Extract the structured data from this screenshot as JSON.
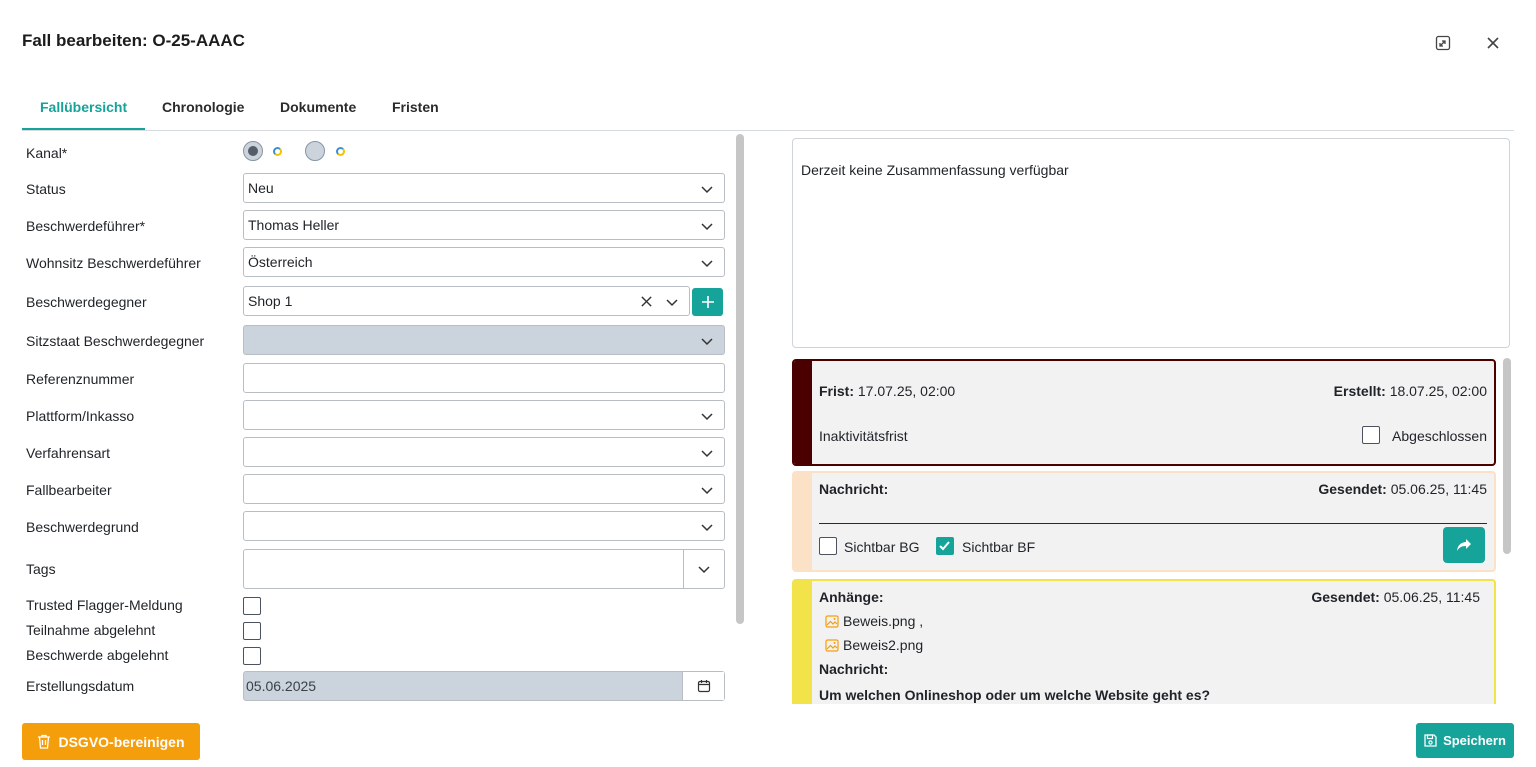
{
  "dialog": {
    "title": "Fall bearbeiten: O-25-AAAC"
  },
  "tabs": [
    {
      "label": "Fallübersicht",
      "active": true
    },
    {
      "label": "Chronologie"
    },
    {
      "label": "Dokumente"
    },
    {
      "label": "Fristen"
    }
  ],
  "form": {
    "kanal_label": "Kanal*",
    "status_label": "Status",
    "status_value": "Neu",
    "beschwerdefuehrer_label": "Beschwerdeführer*",
    "beschwerdefuehrer_value": "Thomas Heller",
    "wohnsitz_label": "Wohnsitz Beschwerdeführer",
    "wohnsitz_value": "Österreich",
    "beschwerdegegner_label": "Beschwerdegegner",
    "beschwerdegegner_value": "Shop 1",
    "sitzstaat_label": "Sitzstaat Beschwerdegegner",
    "sitzstaat_value": "",
    "referenznummer_label": "Referenznummer",
    "referenznummer_value": "",
    "plattform_label": "Plattform/Inkasso",
    "verfahrensart_label": "Verfahrensart",
    "fallbearbeiter_label": "Fallbearbeiter",
    "beschwerdegrund_label": "Beschwerdegrund",
    "tags_label": "Tags",
    "trusted_flagger_label": "Trusted Flagger-Meldung",
    "teilnahme_label": "Teilnahme abgelehnt",
    "beschwerde_abgelehnt_label": "Beschwerde abgelehnt",
    "erstellungsdatum_label": "Erstellungsdatum",
    "erstellungsdatum_value": "05.06.2025"
  },
  "summary": {
    "text": "Derzeit keine Zusammenfassung verfügbar"
  },
  "cards": {
    "frist": {
      "frist_label": "Frist:",
      "frist_value": "17.07.25, 02:00",
      "erstellt_label": "Erstellt:",
      "erstellt_value": "18.07.25, 02:00",
      "type": "Inaktivitätsfrist",
      "abgeschlossen_label": "Abgeschlossen",
      "stripe_color": "#4a0000"
    },
    "nachricht": {
      "nachricht_label": "Nachricht:",
      "gesendet_label": "Gesendet:",
      "gesendet_value": "05.06.25, 11:45",
      "sichtbar_bg_label": "Sichtbar BG",
      "sichtbar_bg_checked": false,
      "sichtbar_bf_label": "Sichtbar BF",
      "sichtbar_bf_checked": true,
      "stripe_color": "#fbe1c6"
    },
    "anhaenge": {
      "anhaenge_label": "Anhänge:",
      "gesendet_label": "Gesendet:",
      "gesendet_value": "05.06.25, 11:45",
      "file1": "Beweis.png ,",
      "file2": "Beweis2.png",
      "nachricht_label": "Nachricht:",
      "question": "Um welchen Onlineshop oder um welche Website geht es?",
      "stripe_color": "#f2e34a"
    }
  },
  "footer": {
    "dsgvo_label": "DSGVO-bereinigen",
    "save_label": "Speichern"
  },
  "colors": {
    "accent": "#16a39a",
    "warning": "#f59e0b"
  }
}
